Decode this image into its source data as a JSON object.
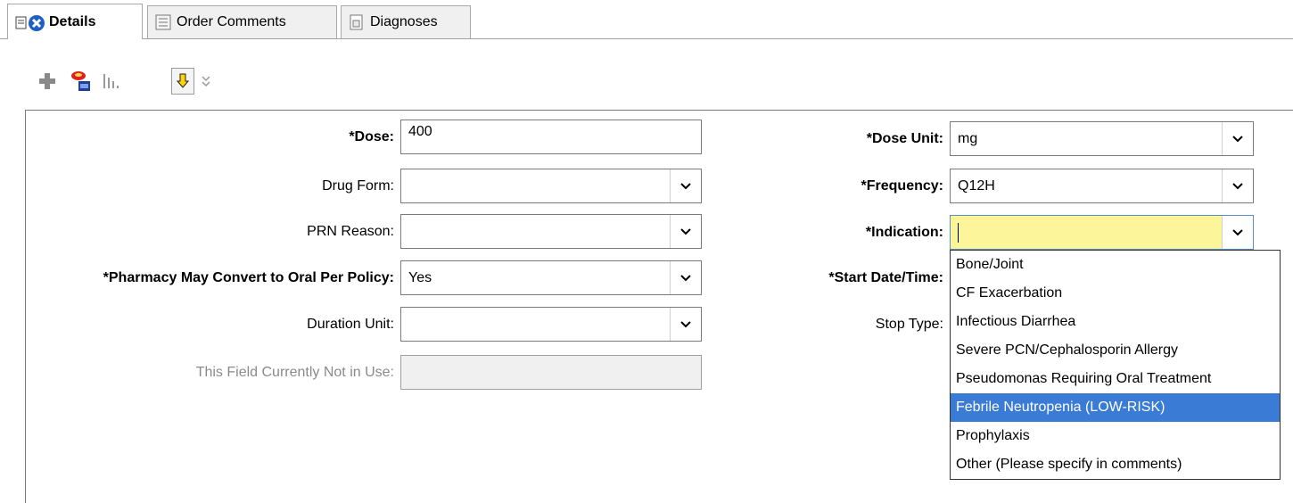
{
  "tabs": [
    {
      "label": "Details",
      "icon": "details-icon",
      "active": true
    },
    {
      "label": "Order Comments",
      "icon": "comments-icon",
      "active": false
    },
    {
      "label": "Diagnoses",
      "icon": "diagnoses-icon",
      "active": false
    }
  ],
  "toolbar": {
    "icons": [
      "add-icon",
      "medication-icon",
      "chart-icon",
      "down-arrow-icon",
      "expand-all-icon"
    ]
  },
  "form": {
    "dose": {
      "label": "*Dose:",
      "value": "400"
    },
    "drug_form": {
      "label": "Drug Form:",
      "value": ""
    },
    "prn_reason": {
      "label": "PRN Reason:",
      "value": ""
    },
    "pharmacy_convert": {
      "label": "*Pharmacy May Convert to Oral Per Policy:",
      "value": "Yes"
    },
    "duration_unit": {
      "label": "Duration Unit:",
      "value": ""
    },
    "not_in_use": {
      "label": "This Field Currently Not in Use:",
      "value": ""
    },
    "dose_unit": {
      "label": "*Dose Unit:",
      "value": "mg"
    },
    "frequency": {
      "label": "*Frequency:",
      "value": "Q12H"
    },
    "indication": {
      "label": "*Indication:",
      "value": ""
    },
    "start_date": {
      "label": "*Start Date/Time:"
    },
    "stop_type": {
      "label": "Stop Type:"
    }
  },
  "indication_options": [
    "Bone/Joint",
    "CF Exacerbation",
    "Infectious Diarrhea",
    "Severe PCN/Cephalosporin Allergy",
    "Pseudomonas Requiring Oral Treatment",
    "Febrile Neutropenia (LOW-RISK)",
    "Prophylaxis",
    "Other (Please specify in comments)"
  ],
  "selected_option_index": 5,
  "colors": {
    "highlight": "#3a7bd5",
    "focus_field": "#fdf59a"
  }
}
